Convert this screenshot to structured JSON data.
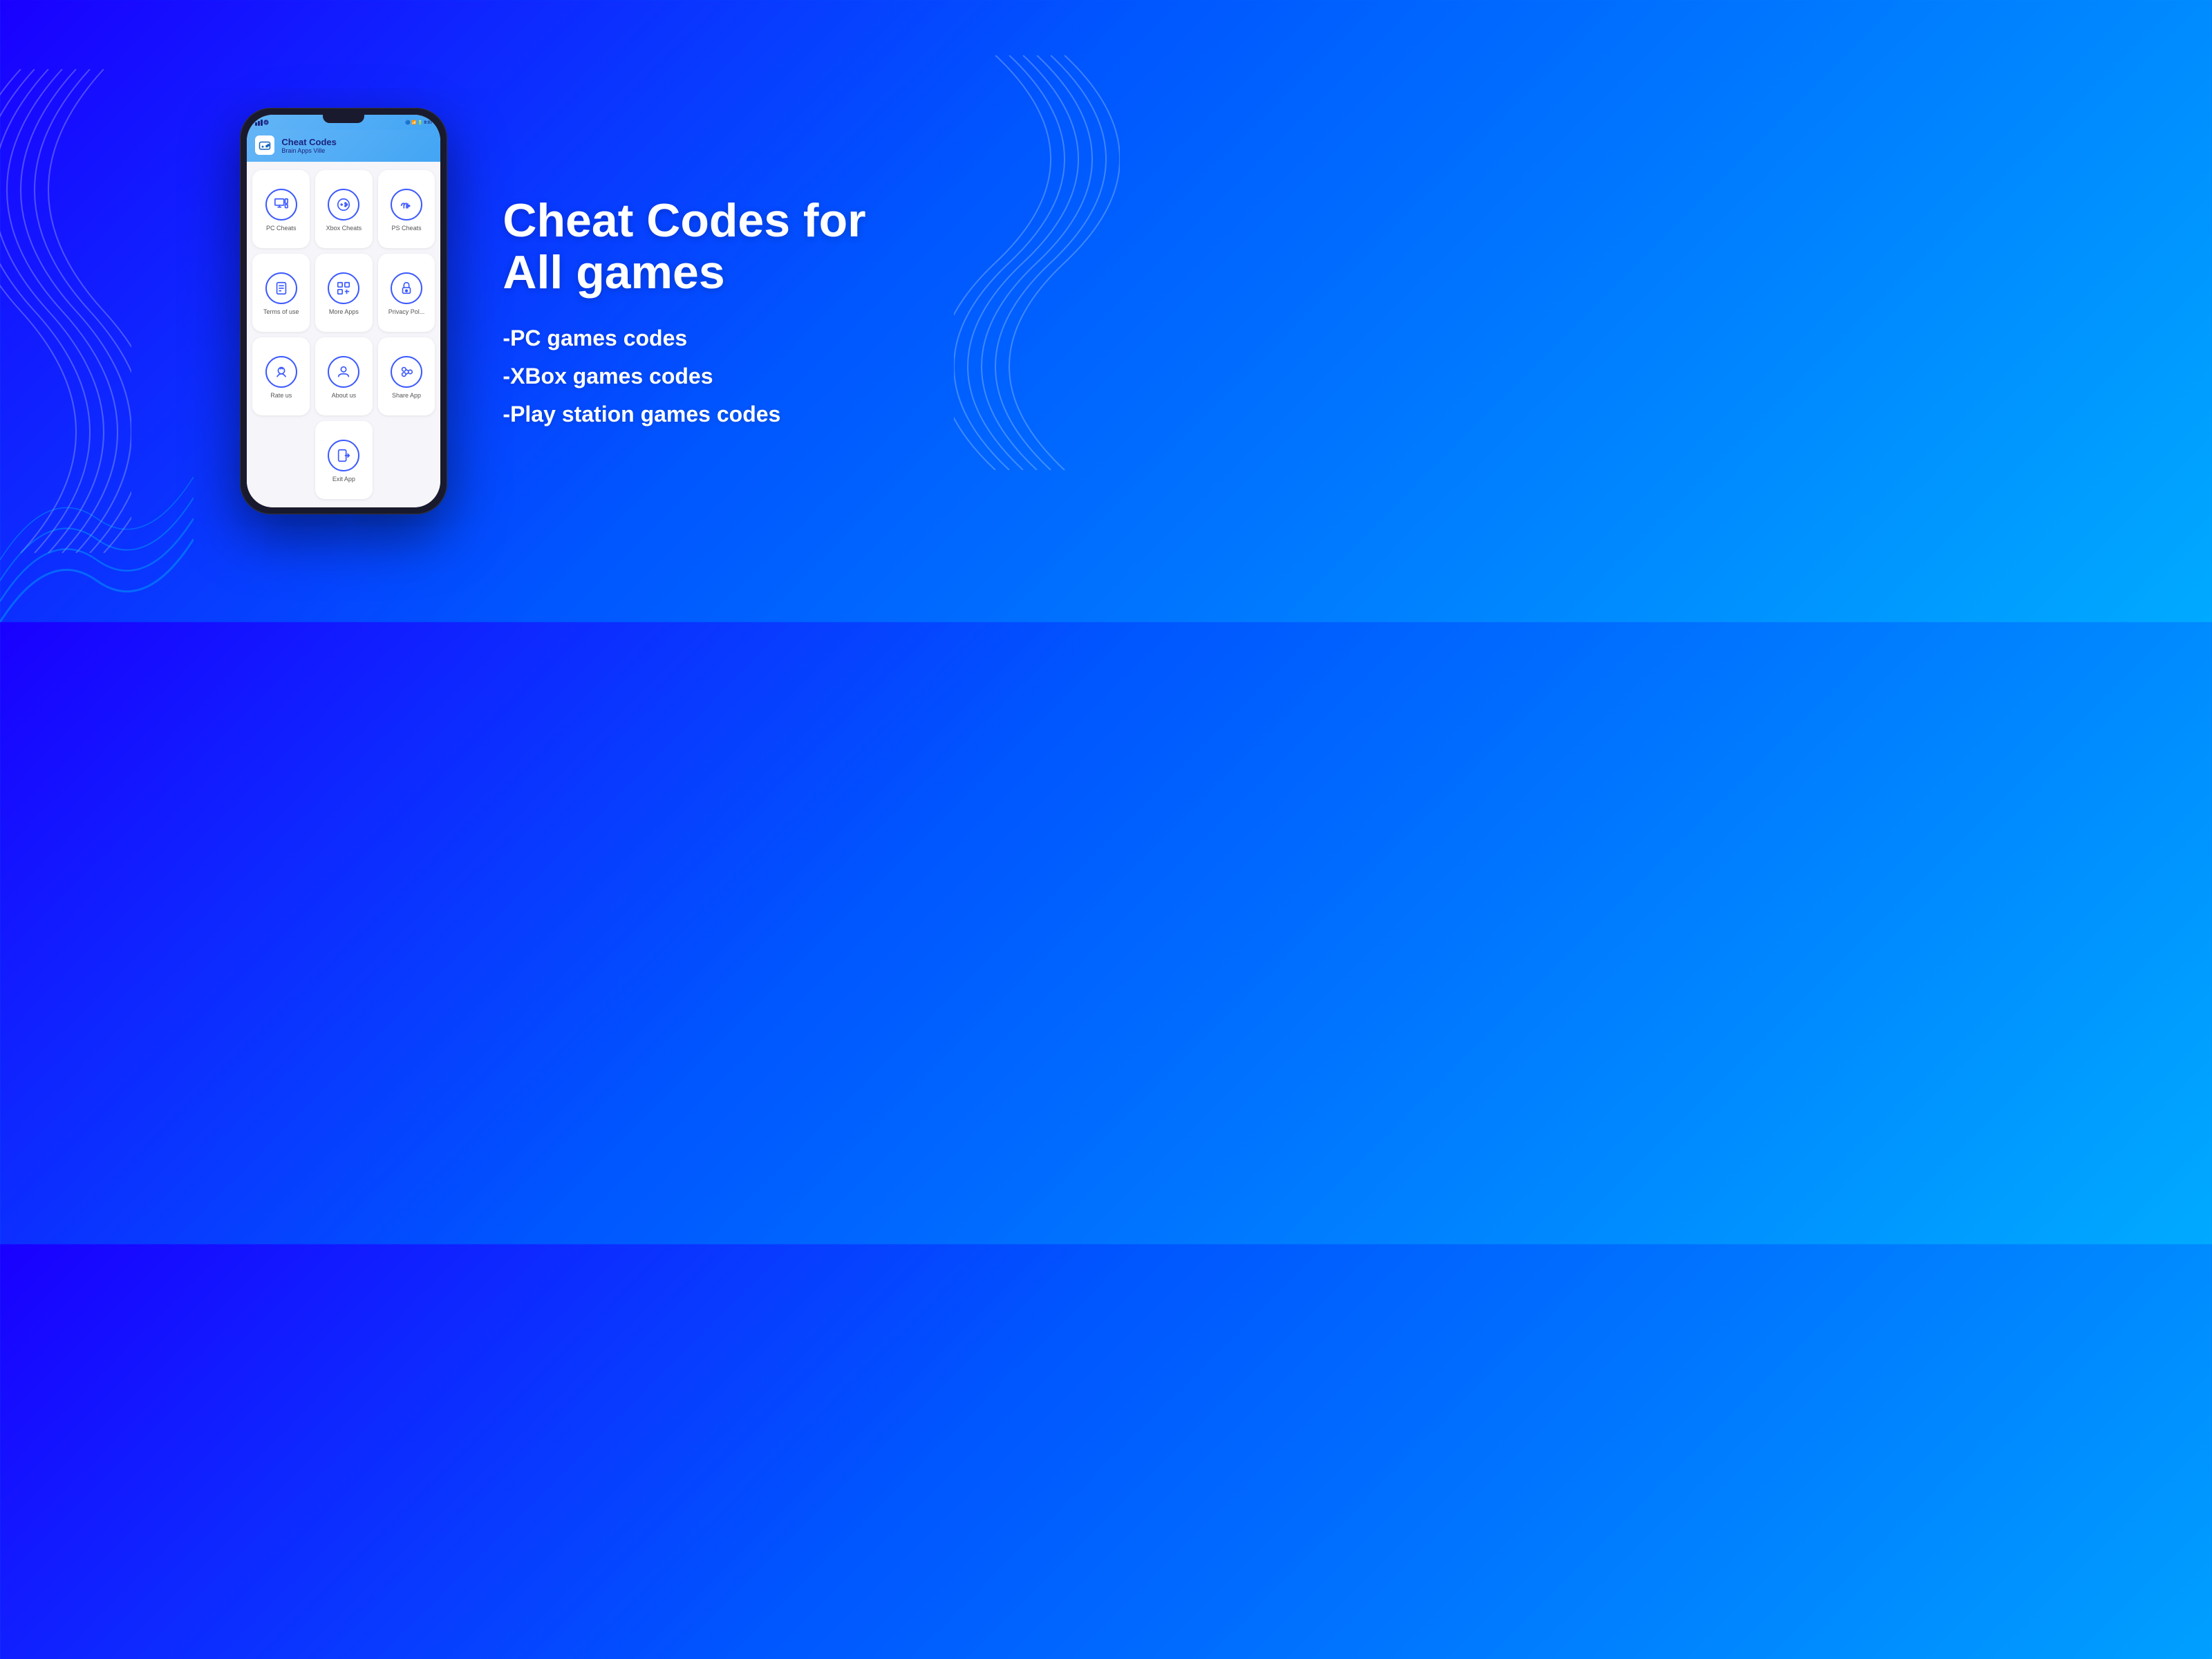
{
  "background": {
    "gradient_start": "#1a00ff",
    "gradient_end": "#00aaff"
  },
  "phone": {
    "status_bar": {
      "left_icons": "📶 📶 🔵",
      "right_icons": "🔵 🔋 9:07"
    },
    "app_header": {
      "icon": "🎮",
      "title": "Cheat Codes",
      "subtitle": "Brain Apps Ville"
    },
    "menu_items": [
      {
        "id": "pc-cheats",
        "label": "PC Cheats",
        "icon": "🖥"
      },
      {
        "id": "xbox-cheats",
        "label": "Xbox Cheats",
        "icon": "🎮"
      },
      {
        "id": "ps-cheats",
        "label": "PS Cheats",
        "icon": "🕹"
      },
      {
        "id": "terms-of-use",
        "label": "Terms of use",
        "icon": "📄"
      },
      {
        "id": "more-apps",
        "label": "More Apps",
        "icon": "⊞"
      },
      {
        "id": "privacy-pol",
        "label": "Privacy Pol...",
        "icon": "🔒"
      },
      {
        "id": "rate-us",
        "label": "Rate us",
        "icon": "⭐"
      },
      {
        "id": "about-us",
        "label": "About us",
        "icon": "👤"
      },
      {
        "id": "share-app",
        "label": "Share App",
        "icon": "👥"
      },
      {
        "id": "exit-app",
        "label": "Exit App",
        "icon": "🚪"
      }
    ]
  },
  "headline_line1": "Cheat Codes for",
  "headline_line2": "All games",
  "features": [
    {
      "id": "pc-codes",
      "text": "-PC games codes"
    },
    {
      "id": "xbox-codes",
      "text": "-XBox games codes"
    },
    {
      "id": "ps-codes",
      "text": "-Play station games codes"
    }
  ]
}
